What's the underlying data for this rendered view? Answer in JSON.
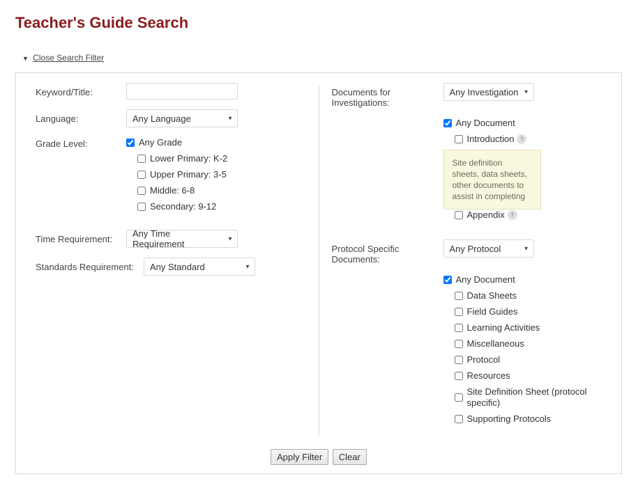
{
  "title": "Teacher's Guide Search",
  "closeLink": "Close Search Filter",
  "left": {
    "keywordLabel": "Keyword/Title:",
    "languageLabel": "Language:",
    "languageSelected": "Any Language",
    "gradeLabel": "Grade Level:",
    "gradeOptions": [
      {
        "label": "Any Grade",
        "checked": true
      },
      {
        "label": "Lower Primary: K-2",
        "checked": false
      },
      {
        "label": "Upper Primary: 3-5",
        "checked": false
      },
      {
        "label": "Middle: 6-8",
        "checked": false
      },
      {
        "label": "Secondary: 9-12",
        "checked": false
      }
    ],
    "timeLabel": "Time Requirement:",
    "timeSelected": "Any Time Requirement",
    "standardsLabel": "Standards Requirement:",
    "standardsSelected": "Any Standard"
  },
  "right": {
    "investigationsLabel": "Documents for Investigations:",
    "investigationsSelected": "Any Investigation",
    "investigationsDocs": {
      "any": {
        "label": "Any Document",
        "checked": true
      },
      "items": [
        {
          "label": "Introduction",
          "checked": false,
          "info": true
        },
        {
          "label": "Appendix",
          "checked": false,
          "info": true
        }
      ]
    },
    "tooltipText": "Site definition sheets, data sheets, other documents to assist in completing",
    "protocolLabel": "Protocol Specific Documents:",
    "protocolSelected": "Any Protocol",
    "protocolDocs": {
      "any": {
        "label": "Any Document",
        "checked": true
      },
      "items": [
        {
          "label": "Data Sheets",
          "checked": false
        },
        {
          "label": "Field Guides",
          "checked": false
        },
        {
          "label": "Learning Activities",
          "checked": false
        },
        {
          "label": "Miscellaneous",
          "checked": false
        },
        {
          "label": "Protocol",
          "checked": false
        },
        {
          "label": "Resources",
          "checked": false
        },
        {
          "label": "Site Definition Sheet (protocol specific)",
          "checked": false
        },
        {
          "label": "Supporting Protocols",
          "checked": false
        }
      ]
    }
  },
  "buttons": {
    "apply": "Apply Filter",
    "clear": "Clear"
  }
}
